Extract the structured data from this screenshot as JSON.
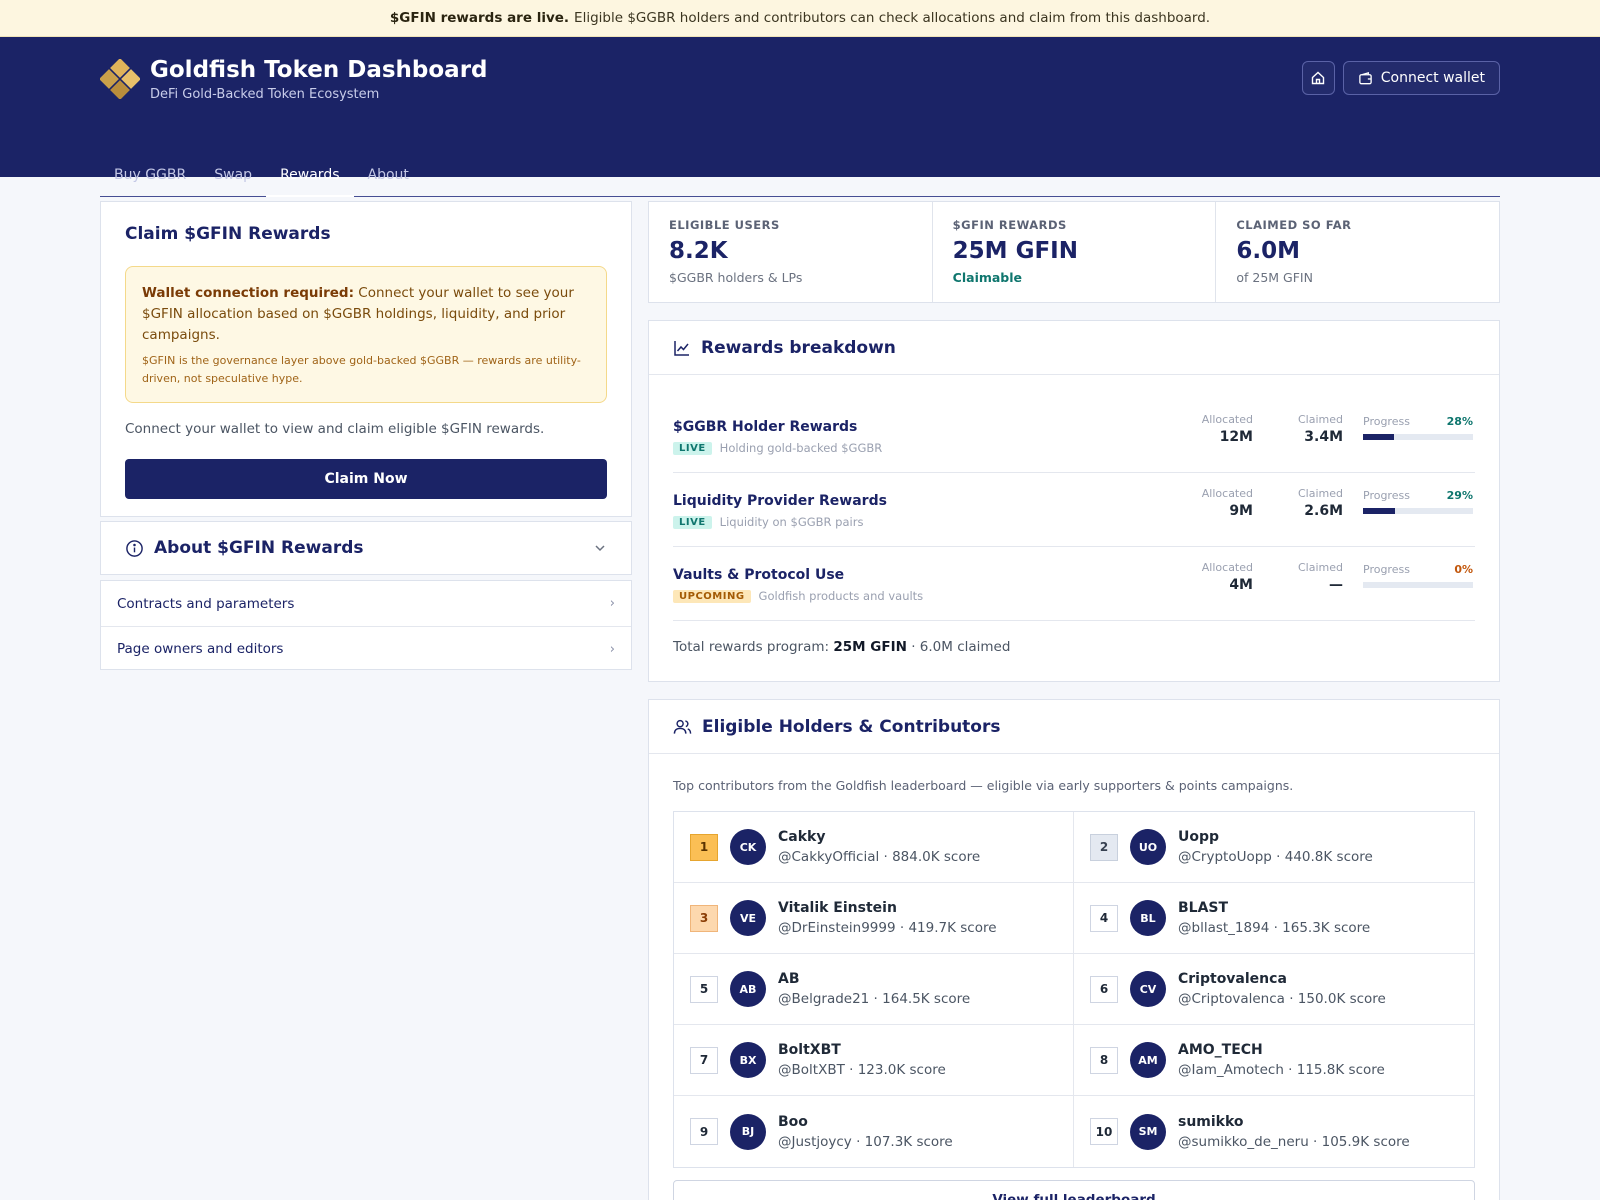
{
  "banner": {
    "bold": "$GFIN rewards are live.",
    "text": "Eligible $GGBR holders and contributors can check allocations and claim from this dashboard."
  },
  "header": {
    "title": "Goldfish Token Dashboard",
    "subtitle": "DeFi Gold-Backed Token Ecosystem",
    "connect_label": "Connect wallet",
    "nav": [
      {
        "label": "Buy GGBR",
        "active": false
      },
      {
        "label": "Swap",
        "active": false
      },
      {
        "label": "Rewards",
        "active": true
      },
      {
        "label": "About",
        "active": false
      }
    ]
  },
  "claim": {
    "title": "Claim $GFIN Rewards",
    "warning_bold": "Wallet connection required:",
    "warning_text": "Connect your wallet to see your $GFIN allocation based on $GGBR holdings, liquidity, and prior campaigns.",
    "warning_note": "$GFIN is the governance layer above gold-backed $GGBR — rewards are utility-driven, not speculative hype.",
    "note": "Connect your wallet to view and claim eligible $GFIN rewards.",
    "button": "Claim Now"
  },
  "about": {
    "title": "About $GFIN Rewards",
    "links": [
      "Contracts and parameters",
      "Page owners and editors"
    ]
  },
  "stats": [
    {
      "label": "ELIGIBLE USERS",
      "value": "8.2K",
      "sub": "$GGBR holders & LPs"
    },
    {
      "label": "$GFIN REWARDS",
      "value": "25M GFIN",
      "sub": "Claimable"
    },
    {
      "label": "CLAIMED SO FAR",
      "value": "6.0M",
      "sub": "of 25M GFIN"
    }
  ],
  "breakdown": {
    "title": "Rewards breakdown",
    "allocated_label": "Allocated",
    "claimed_label": "Claimed",
    "progress_label": "Progress",
    "rows": [
      {
        "name": "$GGBR Holder Rewards",
        "status": "LIVE",
        "desc": "Holding gold-backed $GGBR",
        "allocated": "12M",
        "claimed": "3.4M",
        "progress_text": "28%",
        "progress": 0.28
      },
      {
        "name": "Liquidity Provider Rewards",
        "status": "LIVE",
        "desc": "Liquidity on $GGBR pairs",
        "allocated": "9M",
        "claimed": "2.6M",
        "progress_text": "29%",
        "progress": 0.29
      },
      {
        "name": "Vaults & Protocol Use",
        "status": "UPCOMING",
        "desc": "Goldfish products and vaults",
        "allocated": "4M",
        "claimed": "—",
        "progress_text": "0%",
        "progress": 0
      }
    ],
    "total_prefix": "Total rewards program:",
    "total_bold": "25M GFIN",
    "total_suffix": "· 6.0M claimed"
  },
  "holders": {
    "title": "Eligible Holders & Contributors",
    "intro": "Top contributors from the Goldfish leaderboard — eligible via early supporters & points campaigns.",
    "list": [
      {
        "rank": "1",
        "initials": "CK",
        "name": "Cakky",
        "handle": "@CakkyOfficial · 884.0K score"
      },
      {
        "rank": "2",
        "initials": "UO",
        "name": "Uopp",
        "handle": "@CryptoUopp · 440.8K score"
      },
      {
        "rank": "3",
        "initials": "VE",
        "name": "Vitalik Einstein",
        "handle": "@DrEinstein9999 · 419.7K score"
      },
      {
        "rank": "4",
        "initials": "BL",
        "name": "BLAST",
        "handle": "@bllast_1894 · 165.3K score"
      },
      {
        "rank": "5",
        "initials": "AB",
        "name": "AB",
        "handle": "@Belgrade21 · 164.5K score"
      },
      {
        "rank": "6",
        "initials": "CV",
        "name": "Criptovalenca",
        "handle": "@Criptovalenca · 150.0K score"
      },
      {
        "rank": "7",
        "initials": "BX",
        "name": "BoltXBT",
        "handle": "@BoltXBT · 123.0K score"
      },
      {
        "rank": "8",
        "initials": "AM",
        "name": "AMO_TECH",
        "handle": "@Iam_Amotech · 115.8K score"
      },
      {
        "rank": "9",
        "initials": "BJ",
        "name": "Boo",
        "handle": "@Justjoycy · 107.3K score"
      },
      {
        "rank": "10",
        "initials": "SM",
        "name": "sumikko",
        "handle": "@sumikko_de_neru · 105.9K score"
      }
    ],
    "view_all": "View full leaderboard"
  }
}
